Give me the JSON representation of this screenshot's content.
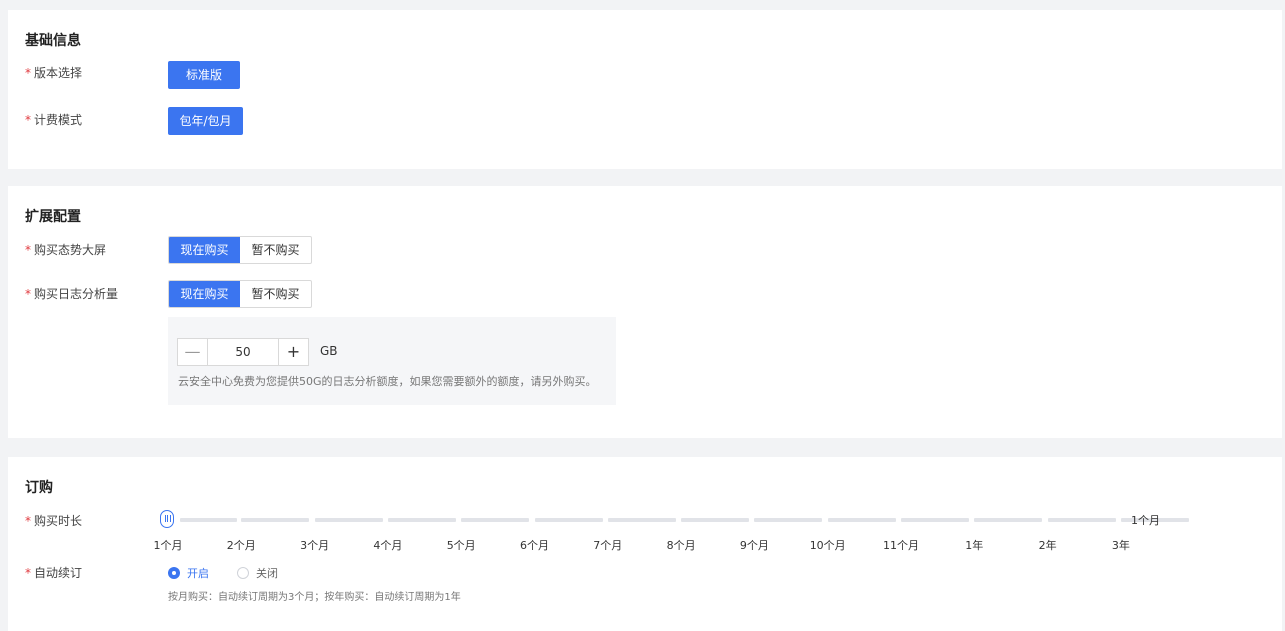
{
  "basic": {
    "title": "基础信息",
    "version_label": "版本选择",
    "version_value": "标准版",
    "billing_label": "计费模式",
    "billing_value": "包年/包月",
    "required_mark": "*"
  },
  "extension": {
    "title": "扩展配置",
    "screen_label": "购买态势大屏",
    "log_label": "购买日志分析量",
    "options": [
      "现在购买",
      "暂不购买"
    ],
    "screen_selected": "现在购买",
    "log_selected": "现在购买",
    "log_amount": "50",
    "log_unit": "GB",
    "minus_icon": "—",
    "plus_icon": "+",
    "hint": "云安全中心免费为您提供50G的日志分析额度，如果您需要额外的额度，请另外购买。"
  },
  "order": {
    "title": "订购",
    "duration_label": "购买时长",
    "duration_ticks": [
      "1个月",
      "2个月",
      "3个月",
      "4个月",
      "5个月",
      "6个月",
      "7个月",
      "8个月",
      "9个月",
      "10个月",
      "11个月",
      "1年",
      "2年",
      "3年"
    ],
    "duration_value": "1个月",
    "renew_label": "自动续订",
    "renew_on": "开启",
    "renew_off": "关闭",
    "renew_selected": "开启",
    "renew_note": "按月购买：自动续订周期为3个月；按年购买：自动续订周期为1年"
  },
  "colors": {
    "accent": "#3b75f0",
    "required": "#e0393e",
    "page_bg": "#f2f3f5"
  }
}
